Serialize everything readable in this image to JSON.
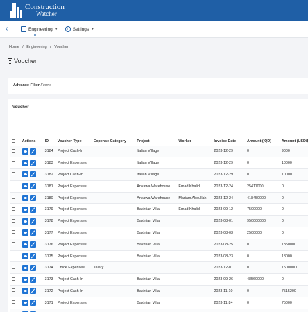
{
  "brand": {
    "line1": "Construction",
    "line2": "Watcher"
  },
  "nav": {
    "back_label": "‹",
    "engineering_label": "Engineering",
    "settings_label": "Settings"
  },
  "breadcrumb": {
    "home": "Home",
    "sep1": "/",
    "engineering": "Engineering",
    "sep2": "/",
    "voucher": "Voucher"
  },
  "page": {
    "title": "Voucher"
  },
  "filter": {
    "label": "Advance Filter",
    "sub": "Forms"
  },
  "voucher_card": {
    "title": "Voucher"
  },
  "table": {
    "headers": [
      "Actions",
      "ID",
      "Voucher Type",
      "Expense Category",
      "Project",
      "Worker",
      "Invoice Date",
      "Amount (IQD)",
      "Amount (USD/$)"
    ],
    "rows": [
      [
        "3184",
        "Project Cash-In",
        "",
        "Italian Village",
        "",
        "2023-12-29",
        "0",
        "9000"
      ],
      [
        "3183",
        "Project Expenses",
        "",
        "Italian Village",
        "",
        "2023-12-29",
        "0",
        "10000"
      ],
      [
        "3182",
        "Project Cash-In",
        "",
        "Italian Village",
        "",
        "2023-12-29",
        "0",
        "10000"
      ],
      [
        "3181",
        "Project Expenses",
        "",
        "Ankawa Warehouse",
        "Emad Khalid",
        "2023-12-24",
        "25411000",
        "0"
      ],
      [
        "3180",
        "Project Expenses",
        "",
        "Ankawa Warehouse",
        "Mariam Abdullah",
        "2023-12-24",
        "418450000",
        "0"
      ],
      [
        "3179",
        "Project Expenses",
        "",
        "Bakhtiari Villa",
        "Emad Khalid",
        "2023-09-12",
        "7500000",
        "0"
      ],
      [
        "3178",
        "Project Expenses",
        "",
        "Bakhtiari Villa",
        "",
        "2023-08-01",
        "950000000",
        "0"
      ],
      [
        "3177",
        "Project Expenses",
        "",
        "Bakhtiari Villa",
        "",
        "2023-08-03",
        "2500000",
        "0"
      ],
      [
        "3176",
        "Project Expenses",
        "",
        "Bakhtiari Villa",
        "",
        "2023-08-25",
        "0",
        "1850000"
      ],
      [
        "3175",
        "Project Expenses",
        "",
        "Bakhtiari Villa",
        "",
        "2023-08-23",
        "0",
        "18000"
      ],
      [
        "3174",
        "Office Expenses",
        "salary",
        "",
        "",
        "2023-12-01",
        "0",
        "15000000"
      ],
      [
        "3173",
        "Project Cash-In",
        "",
        "Bakhtiari Villa",
        "",
        "2023-09-26",
        "48560000",
        "0"
      ],
      [
        "3172",
        "Project Cash-In",
        "",
        "Bakhtiari Villa",
        "",
        "2023-11-10",
        "0",
        "7515200"
      ],
      [
        "3171",
        "Project Expenses",
        "",
        "Bakhtiari Villa",
        "",
        "2023-11-24",
        "0",
        "75000"
      ],
      [
        "3170",
        "Project Expenses",
        "",
        "Bakhtiari Villa",
        "",
        "2023-11-26",
        "0",
        "85500"
      ]
    ]
  }
}
